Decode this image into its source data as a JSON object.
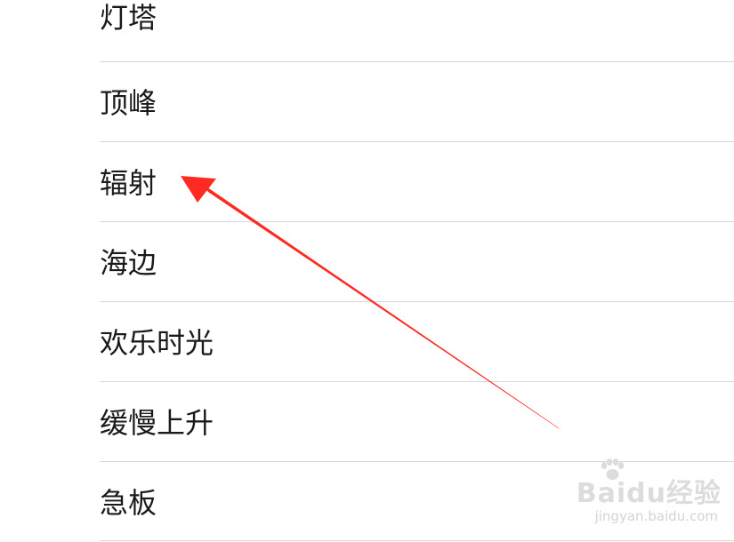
{
  "list": {
    "items": [
      {
        "label": "灯塔"
      },
      {
        "label": "顶峰"
      },
      {
        "label": "辐射"
      },
      {
        "label": "海边"
      },
      {
        "label": "欢乐时光"
      },
      {
        "label": "缓慢上升"
      },
      {
        "label": "急板"
      }
    ]
  },
  "annotation": {
    "arrow_color": "#ff2a22",
    "points_to": "辐射"
  },
  "watermark": {
    "brand": "Baidu经验",
    "url": "jingyan.baidu.com"
  }
}
